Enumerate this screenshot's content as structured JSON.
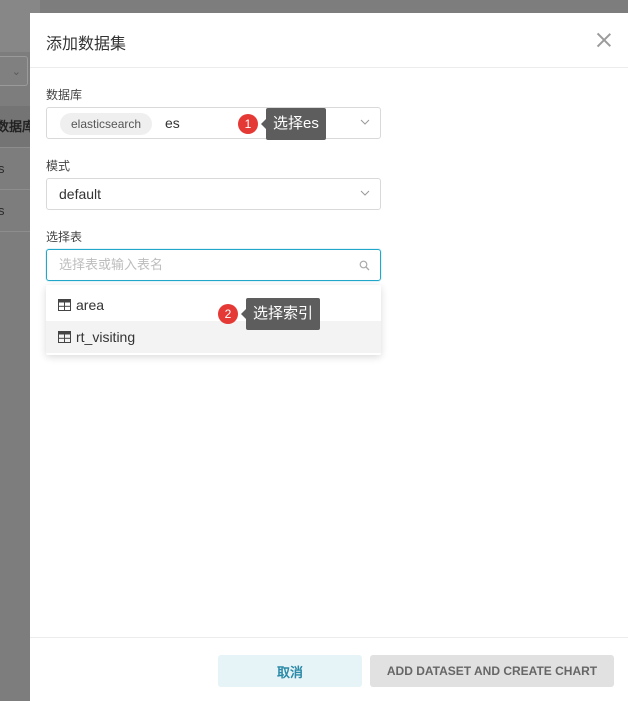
{
  "background": {
    "items": [
      "数据库",
      "s",
      "s"
    ]
  },
  "modal": {
    "title": "添加数据集",
    "database": {
      "label": "数据库",
      "tag": "elasticsearch",
      "value": "es"
    },
    "schema": {
      "label": "模式",
      "value": "default"
    },
    "table": {
      "label": "选择表",
      "placeholder": "选择表或输入表名",
      "options": [
        "area",
        "rt_visiting"
      ]
    },
    "footer": {
      "cancel_label": "取消",
      "add_label": "ADD DATASET AND CREATE CHART"
    }
  },
  "annotations": [
    {
      "number": "1",
      "text": "选择es"
    },
    {
      "number": "2",
      "text": "选择索引"
    }
  ],
  "colors": {
    "accent": "#20a7c9",
    "badge": "#e53935",
    "callout": "#5d5d5d"
  }
}
